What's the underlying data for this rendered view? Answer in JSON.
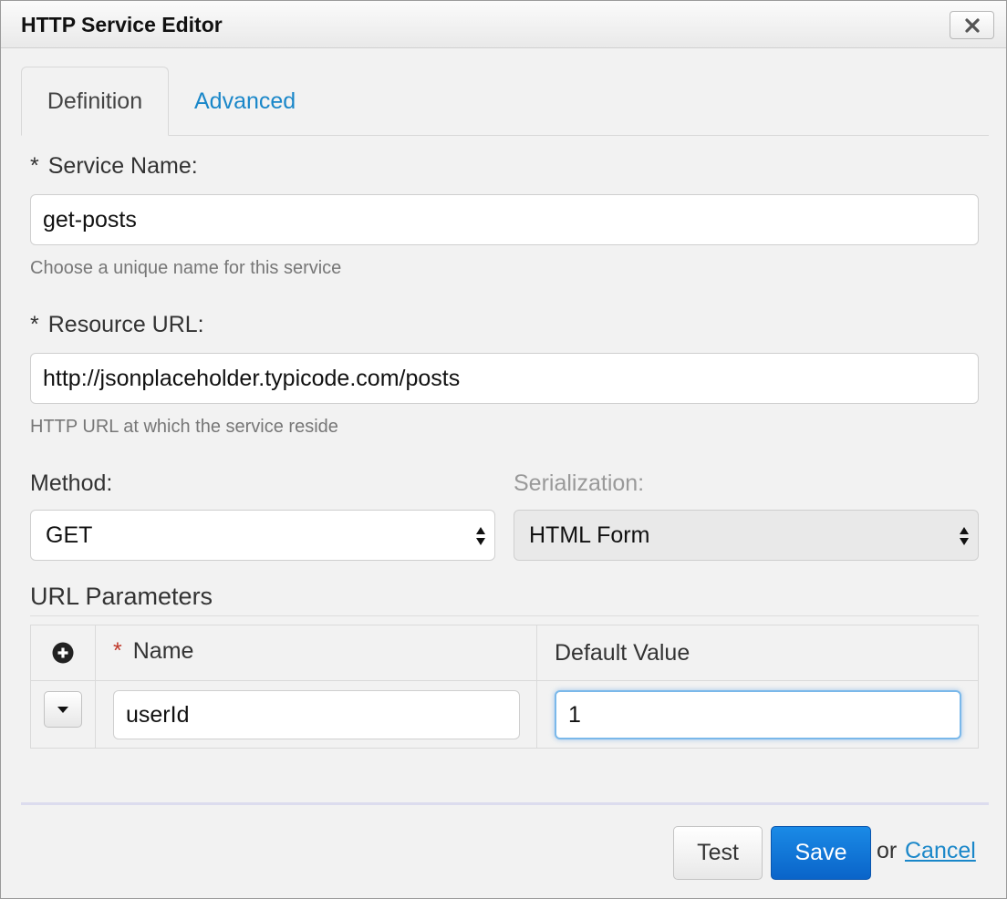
{
  "dialog": {
    "title": "HTTP Service Editor",
    "close_icon": "close-icon"
  },
  "tabs": [
    {
      "label": "Definition",
      "active": true
    },
    {
      "label": "Advanced",
      "active": false
    }
  ],
  "form": {
    "service_name": {
      "required_mark": "*",
      "label": "Service Name:",
      "value": "get-posts",
      "help": "Choose a unique name for this service"
    },
    "resource_url": {
      "required_mark": "*",
      "label": "Resource URL:",
      "value": "http://jsonplaceholder.typicode.com/posts",
      "help": "HTTP URL at which the service reside"
    },
    "method": {
      "label": "Method:",
      "value": "GET"
    },
    "serialization": {
      "label": "Serialization:",
      "value": "HTML Form",
      "disabled": true
    }
  },
  "url_parameters": {
    "title": "URL Parameters",
    "add_icon": "plus-circle-icon",
    "columns": {
      "name_required": "*",
      "name": "Name",
      "default_value": "Default Value"
    },
    "rows": [
      {
        "name": "userId",
        "default_value": "1",
        "toggle_icon": "caret-down-icon"
      }
    ]
  },
  "footer": {
    "test_label": "Test",
    "save_label": "Save",
    "or_text": "or",
    "cancel_label": "Cancel"
  },
  "colors": {
    "link": "#1a87c9",
    "primary_button": "#0a64c9",
    "required_star": "#c0392b",
    "focus_border": "#6fb2e8"
  }
}
